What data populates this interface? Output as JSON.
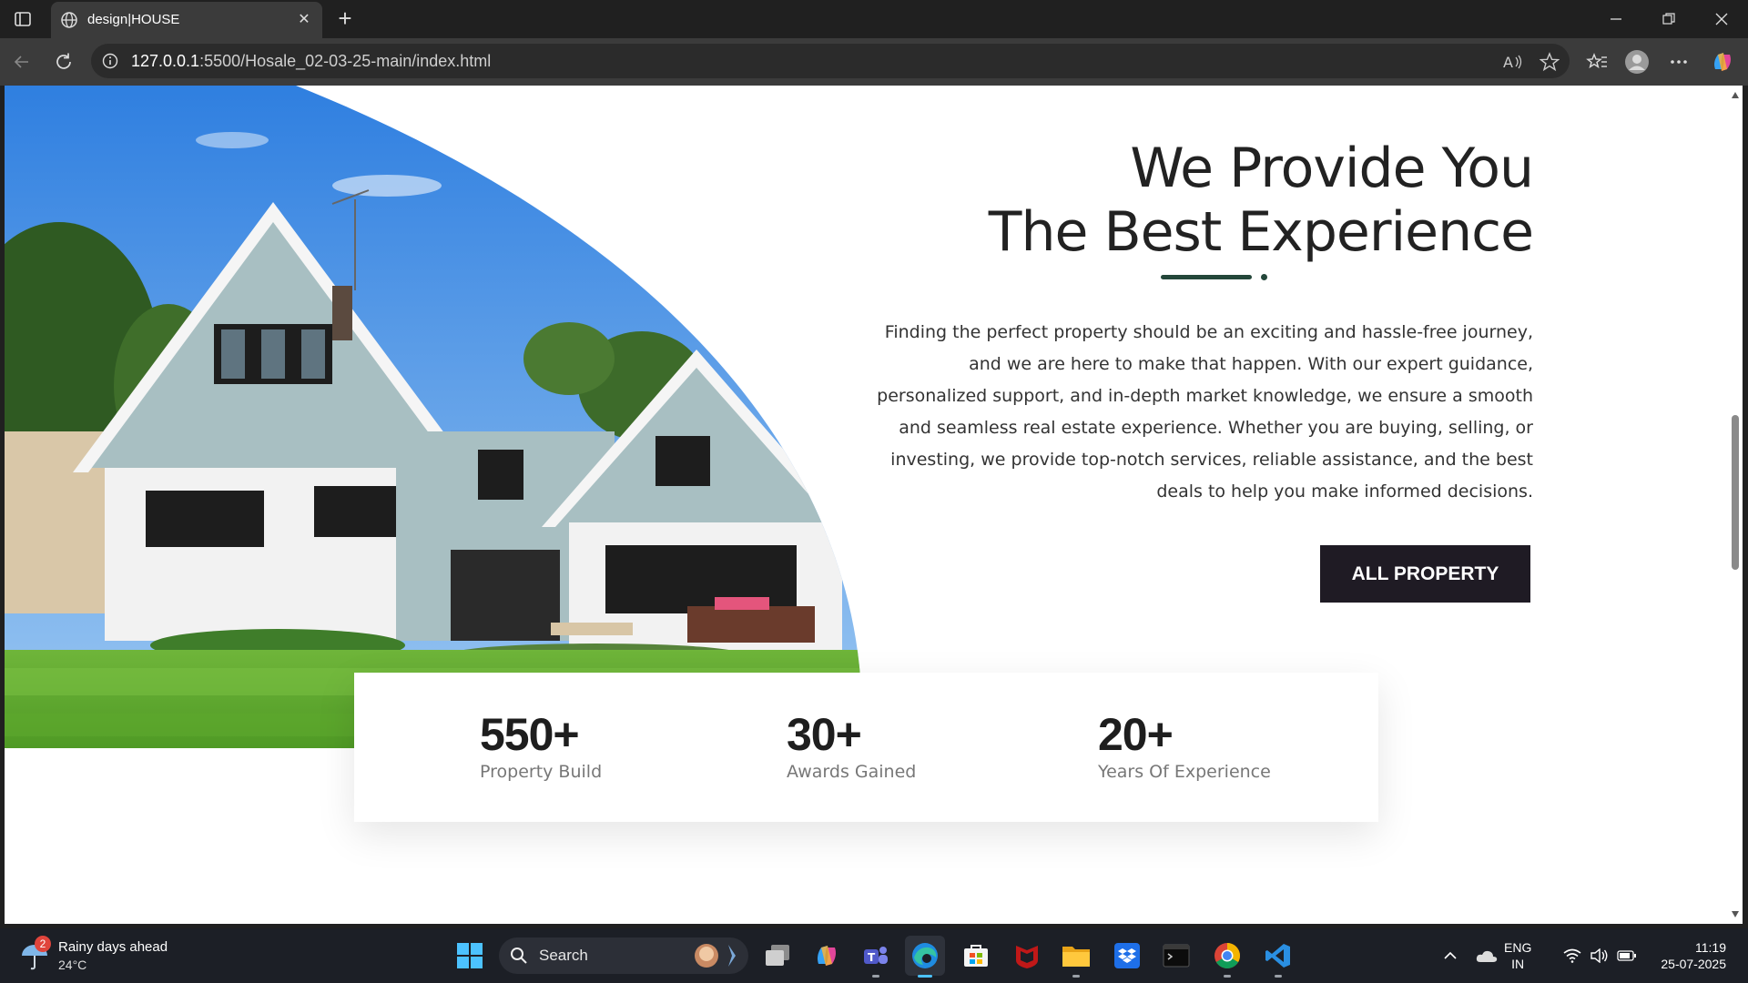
{
  "browser": {
    "tab_title": "design|HOUSE",
    "url_host": "127.0.0.1",
    "url_rest": ":5500/Hosale_02-03-25-main/index.html"
  },
  "page": {
    "heading_line1": "We Provide You",
    "heading_line2": "The Best Experience",
    "description": "Finding the perfect property should be an exciting and hassle-free journey, and we are here to make that happen. With our expert guidance, personalized support, and in-depth market knowledge, we ensure a smooth and seamless real estate experience. Whether you are buying, selling, or investing, we provide top-notch services, reliable assistance, and the best deals to help you make informed decisions.",
    "cta_label": "ALL PROPERTY",
    "stats": [
      {
        "value": "550+",
        "label": "Property Build"
      },
      {
        "value": "30+",
        "label": "Awards Gained"
      },
      {
        "value": "20+",
        "label": "Years Of Experience"
      }
    ],
    "colors": {
      "accent": "#24473a",
      "button": "#1f1b24"
    }
  },
  "taskbar": {
    "weather_badge": "2",
    "weather_title": "Rainy days ahead",
    "weather_temp": "24°C",
    "search_placeholder": "Search",
    "lang_line1": "ENG",
    "lang_line2": "IN",
    "time": "11:19",
    "date": "25-07-2025"
  }
}
